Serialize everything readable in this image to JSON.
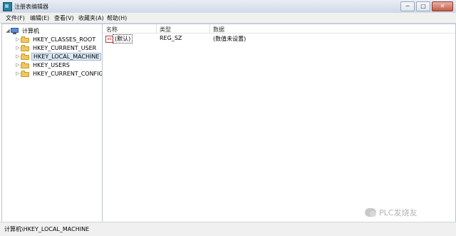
{
  "window": {
    "title": "注册表编辑器",
    "controls": {
      "minimize": "─",
      "maximize": "□",
      "close": "✕"
    }
  },
  "menu": {
    "file": "文件(F)",
    "edit": "编辑(E)",
    "view": "查看(V)",
    "favorites": "收藏夹(A)",
    "help": "帮助(H)"
  },
  "tree": {
    "root_expander": "◢",
    "root": "计算机",
    "collapsed_symbol": "▷",
    "items": [
      {
        "label": "HKEY_CLASSES_ROOT"
      },
      {
        "label": "HKEY_CURRENT_USER"
      },
      {
        "label": "HKEY_LOCAL_MACHINE"
      },
      {
        "label": "HKEY_USERS"
      },
      {
        "label": "HKEY_CURRENT_CONFIG"
      }
    ]
  },
  "list": {
    "columns": {
      "name": "名称",
      "type": "类型",
      "data": "数据"
    },
    "rows": [
      {
        "icon": "ab",
        "name": "(默认)",
        "type": "REG_SZ",
        "data": "(数值未设置)"
      }
    ]
  },
  "statusbar": {
    "path": "计算机\\HKEY_LOCAL_MACHINE"
  },
  "watermark": {
    "text": "PLC发烧友"
  }
}
